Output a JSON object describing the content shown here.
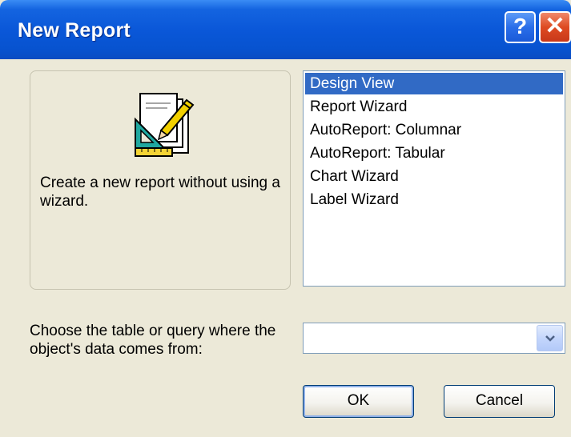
{
  "window": {
    "title": "New Report"
  },
  "titlebar": {
    "help_label": "?",
    "close_label": "✕"
  },
  "description": {
    "text": "Create a new report without using a wizard."
  },
  "report_types": {
    "items": [
      {
        "label": "Design View",
        "selected": true
      },
      {
        "label": "Report Wizard",
        "selected": false
      },
      {
        "label": "AutoReport:  Columnar",
        "selected": false
      },
      {
        "label": "AutoReport:  Tabular",
        "selected": false
      },
      {
        "label": "Chart Wizard",
        "selected": false
      },
      {
        "label": "Label Wizard",
        "selected": false
      }
    ],
    "selected_color": "#316ac5"
  },
  "source": {
    "prompt": "Choose the table or query where the object's data comes from:",
    "value": ""
  },
  "buttons": {
    "ok_label": "OK",
    "cancel_label": "Cancel"
  },
  "icons": {
    "report": "report-design-icon",
    "dropdown": "chevron-down-icon"
  }
}
